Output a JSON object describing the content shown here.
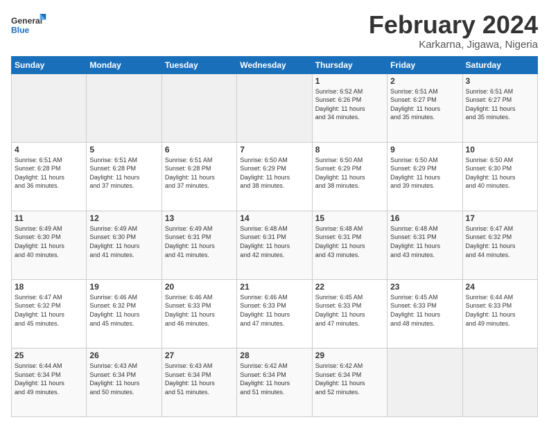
{
  "logo": {
    "line1": "General",
    "line2": "Blue"
  },
  "title": "February 2024",
  "location": "Karkarna, Jigawa, Nigeria",
  "weekdays": [
    "Sunday",
    "Monday",
    "Tuesday",
    "Wednesday",
    "Thursday",
    "Friday",
    "Saturday"
  ],
  "weeks": [
    [
      {
        "day": "",
        "info": ""
      },
      {
        "day": "",
        "info": ""
      },
      {
        "day": "",
        "info": ""
      },
      {
        "day": "",
        "info": ""
      },
      {
        "day": "1",
        "info": "Sunrise: 6:52 AM\nSunset: 6:26 PM\nDaylight: 11 hours\nand 34 minutes."
      },
      {
        "day": "2",
        "info": "Sunrise: 6:51 AM\nSunset: 6:27 PM\nDaylight: 11 hours\nand 35 minutes."
      },
      {
        "day": "3",
        "info": "Sunrise: 6:51 AM\nSunset: 6:27 PM\nDaylight: 11 hours\nand 35 minutes."
      }
    ],
    [
      {
        "day": "4",
        "info": "Sunrise: 6:51 AM\nSunset: 6:28 PM\nDaylight: 11 hours\nand 36 minutes."
      },
      {
        "day": "5",
        "info": "Sunrise: 6:51 AM\nSunset: 6:28 PM\nDaylight: 11 hours\nand 37 minutes."
      },
      {
        "day": "6",
        "info": "Sunrise: 6:51 AM\nSunset: 6:28 PM\nDaylight: 11 hours\nand 37 minutes."
      },
      {
        "day": "7",
        "info": "Sunrise: 6:50 AM\nSunset: 6:29 PM\nDaylight: 11 hours\nand 38 minutes."
      },
      {
        "day": "8",
        "info": "Sunrise: 6:50 AM\nSunset: 6:29 PM\nDaylight: 11 hours\nand 38 minutes."
      },
      {
        "day": "9",
        "info": "Sunrise: 6:50 AM\nSunset: 6:29 PM\nDaylight: 11 hours\nand 39 minutes."
      },
      {
        "day": "10",
        "info": "Sunrise: 6:50 AM\nSunset: 6:30 PM\nDaylight: 11 hours\nand 40 minutes."
      }
    ],
    [
      {
        "day": "11",
        "info": "Sunrise: 6:49 AM\nSunset: 6:30 PM\nDaylight: 11 hours\nand 40 minutes."
      },
      {
        "day": "12",
        "info": "Sunrise: 6:49 AM\nSunset: 6:30 PM\nDaylight: 11 hours\nand 41 minutes."
      },
      {
        "day": "13",
        "info": "Sunrise: 6:49 AM\nSunset: 6:31 PM\nDaylight: 11 hours\nand 41 minutes."
      },
      {
        "day": "14",
        "info": "Sunrise: 6:48 AM\nSunset: 6:31 PM\nDaylight: 11 hours\nand 42 minutes."
      },
      {
        "day": "15",
        "info": "Sunrise: 6:48 AM\nSunset: 6:31 PM\nDaylight: 11 hours\nand 43 minutes."
      },
      {
        "day": "16",
        "info": "Sunrise: 6:48 AM\nSunset: 6:31 PM\nDaylight: 11 hours\nand 43 minutes."
      },
      {
        "day": "17",
        "info": "Sunrise: 6:47 AM\nSunset: 6:32 PM\nDaylight: 11 hours\nand 44 minutes."
      }
    ],
    [
      {
        "day": "18",
        "info": "Sunrise: 6:47 AM\nSunset: 6:32 PM\nDaylight: 11 hours\nand 45 minutes."
      },
      {
        "day": "19",
        "info": "Sunrise: 6:46 AM\nSunset: 6:32 PM\nDaylight: 11 hours\nand 45 minutes."
      },
      {
        "day": "20",
        "info": "Sunrise: 6:46 AM\nSunset: 6:33 PM\nDaylight: 11 hours\nand 46 minutes."
      },
      {
        "day": "21",
        "info": "Sunrise: 6:46 AM\nSunset: 6:33 PM\nDaylight: 11 hours\nand 47 minutes."
      },
      {
        "day": "22",
        "info": "Sunrise: 6:45 AM\nSunset: 6:33 PM\nDaylight: 11 hours\nand 47 minutes."
      },
      {
        "day": "23",
        "info": "Sunrise: 6:45 AM\nSunset: 6:33 PM\nDaylight: 11 hours\nand 48 minutes."
      },
      {
        "day": "24",
        "info": "Sunrise: 6:44 AM\nSunset: 6:33 PM\nDaylight: 11 hours\nand 49 minutes."
      }
    ],
    [
      {
        "day": "25",
        "info": "Sunrise: 6:44 AM\nSunset: 6:34 PM\nDaylight: 11 hours\nand 49 minutes."
      },
      {
        "day": "26",
        "info": "Sunrise: 6:43 AM\nSunset: 6:34 PM\nDaylight: 11 hours\nand 50 minutes."
      },
      {
        "day": "27",
        "info": "Sunrise: 6:43 AM\nSunset: 6:34 PM\nDaylight: 11 hours\nand 51 minutes."
      },
      {
        "day": "28",
        "info": "Sunrise: 6:42 AM\nSunset: 6:34 PM\nDaylight: 11 hours\nand 51 minutes."
      },
      {
        "day": "29",
        "info": "Sunrise: 6:42 AM\nSunset: 6:34 PM\nDaylight: 11 hours\nand 52 minutes."
      },
      {
        "day": "",
        "info": ""
      },
      {
        "day": "",
        "info": ""
      }
    ]
  ]
}
